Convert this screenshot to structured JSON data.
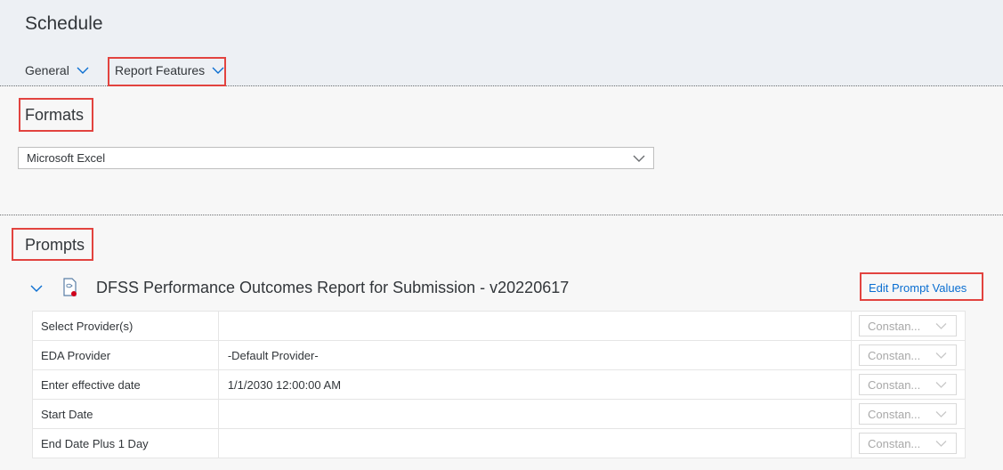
{
  "header": {
    "title": "Schedule",
    "tabs": [
      {
        "label": "General"
      },
      {
        "label": "Report Features"
      }
    ]
  },
  "formats": {
    "title": "Formats",
    "selected": "Microsoft Excel"
  },
  "prompts": {
    "title": "Prompts",
    "report_name": "DFSS Performance Outcomes Report for Submission - v20220617",
    "edit_label": "Edit Prompt Values",
    "rows": [
      {
        "name": "Select Provider(s)",
        "value": "",
        "type": "Constan..."
      },
      {
        "name": "EDA Provider",
        "value": "-Default Provider-",
        "type": "Constan..."
      },
      {
        "name": "Enter effective date",
        "value": "1/1/2030 12:00:00 AM",
        "type": "Constan..."
      },
      {
        "name": "Start Date",
        "value": "",
        "type": "Constan..."
      },
      {
        "name": "End Date Plus 1 Day",
        "value": "",
        "type": "Constan..."
      }
    ]
  },
  "colors": {
    "highlight": "#e2433f",
    "link": "#0a6ed1",
    "header_bg": "#edf0f4"
  }
}
